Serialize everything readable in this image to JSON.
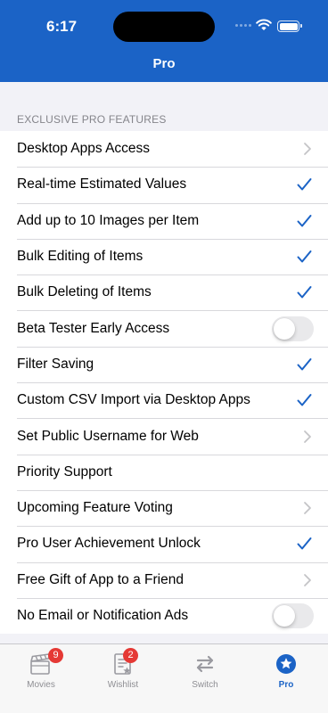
{
  "status_bar": {
    "time": "6:17"
  },
  "nav": {
    "title": "Pro"
  },
  "section": {
    "header": "EXCLUSIVE PRO FEATURES"
  },
  "rows": [
    {
      "label": "Desktop Apps Access",
      "accessory": "chevron"
    },
    {
      "label": "Real-time Estimated Values",
      "accessory": "check"
    },
    {
      "label": "Add up to 10 Images per Item",
      "accessory": "check"
    },
    {
      "label": "Bulk Editing of Items",
      "accessory": "check"
    },
    {
      "label": "Bulk Deleting of Items",
      "accessory": "check"
    },
    {
      "label": "Beta Tester Early Access",
      "accessory": "toggle",
      "on": false
    },
    {
      "label": "Filter Saving",
      "accessory": "check"
    },
    {
      "label": "Custom CSV Import via Desktop Apps",
      "accessory": "check"
    },
    {
      "label": "Set Public Username for Web",
      "accessory": "chevron"
    },
    {
      "label": "Priority Support",
      "accessory": "none"
    },
    {
      "label": "Upcoming Feature Voting",
      "accessory": "chevron"
    },
    {
      "label": "Pro User Achievement Unlock",
      "accessory": "check"
    },
    {
      "label": "Free Gift of App to a Friend",
      "accessory": "chevron"
    },
    {
      "label": "No Email or Notification Ads",
      "accessory": "toggle",
      "on": false
    }
  ],
  "tabs": [
    {
      "label": "Movies",
      "badge": "9",
      "icon": "clapperboard-icon"
    },
    {
      "label": "Wishlist",
      "badge": "2",
      "icon": "wishlist-icon"
    },
    {
      "label": "Switch",
      "badge": "",
      "icon": "switch-arrows-icon"
    },
    {
      "label": "Pro",
      "badge": "",
      "icon": "star-circle-icon",
      "active": true
    }
  ],
  "colors": {
    "accent": "#1b63c6",
    "badge": "#e53935",
    "checkmark": "#1b63c6"
  }
}
